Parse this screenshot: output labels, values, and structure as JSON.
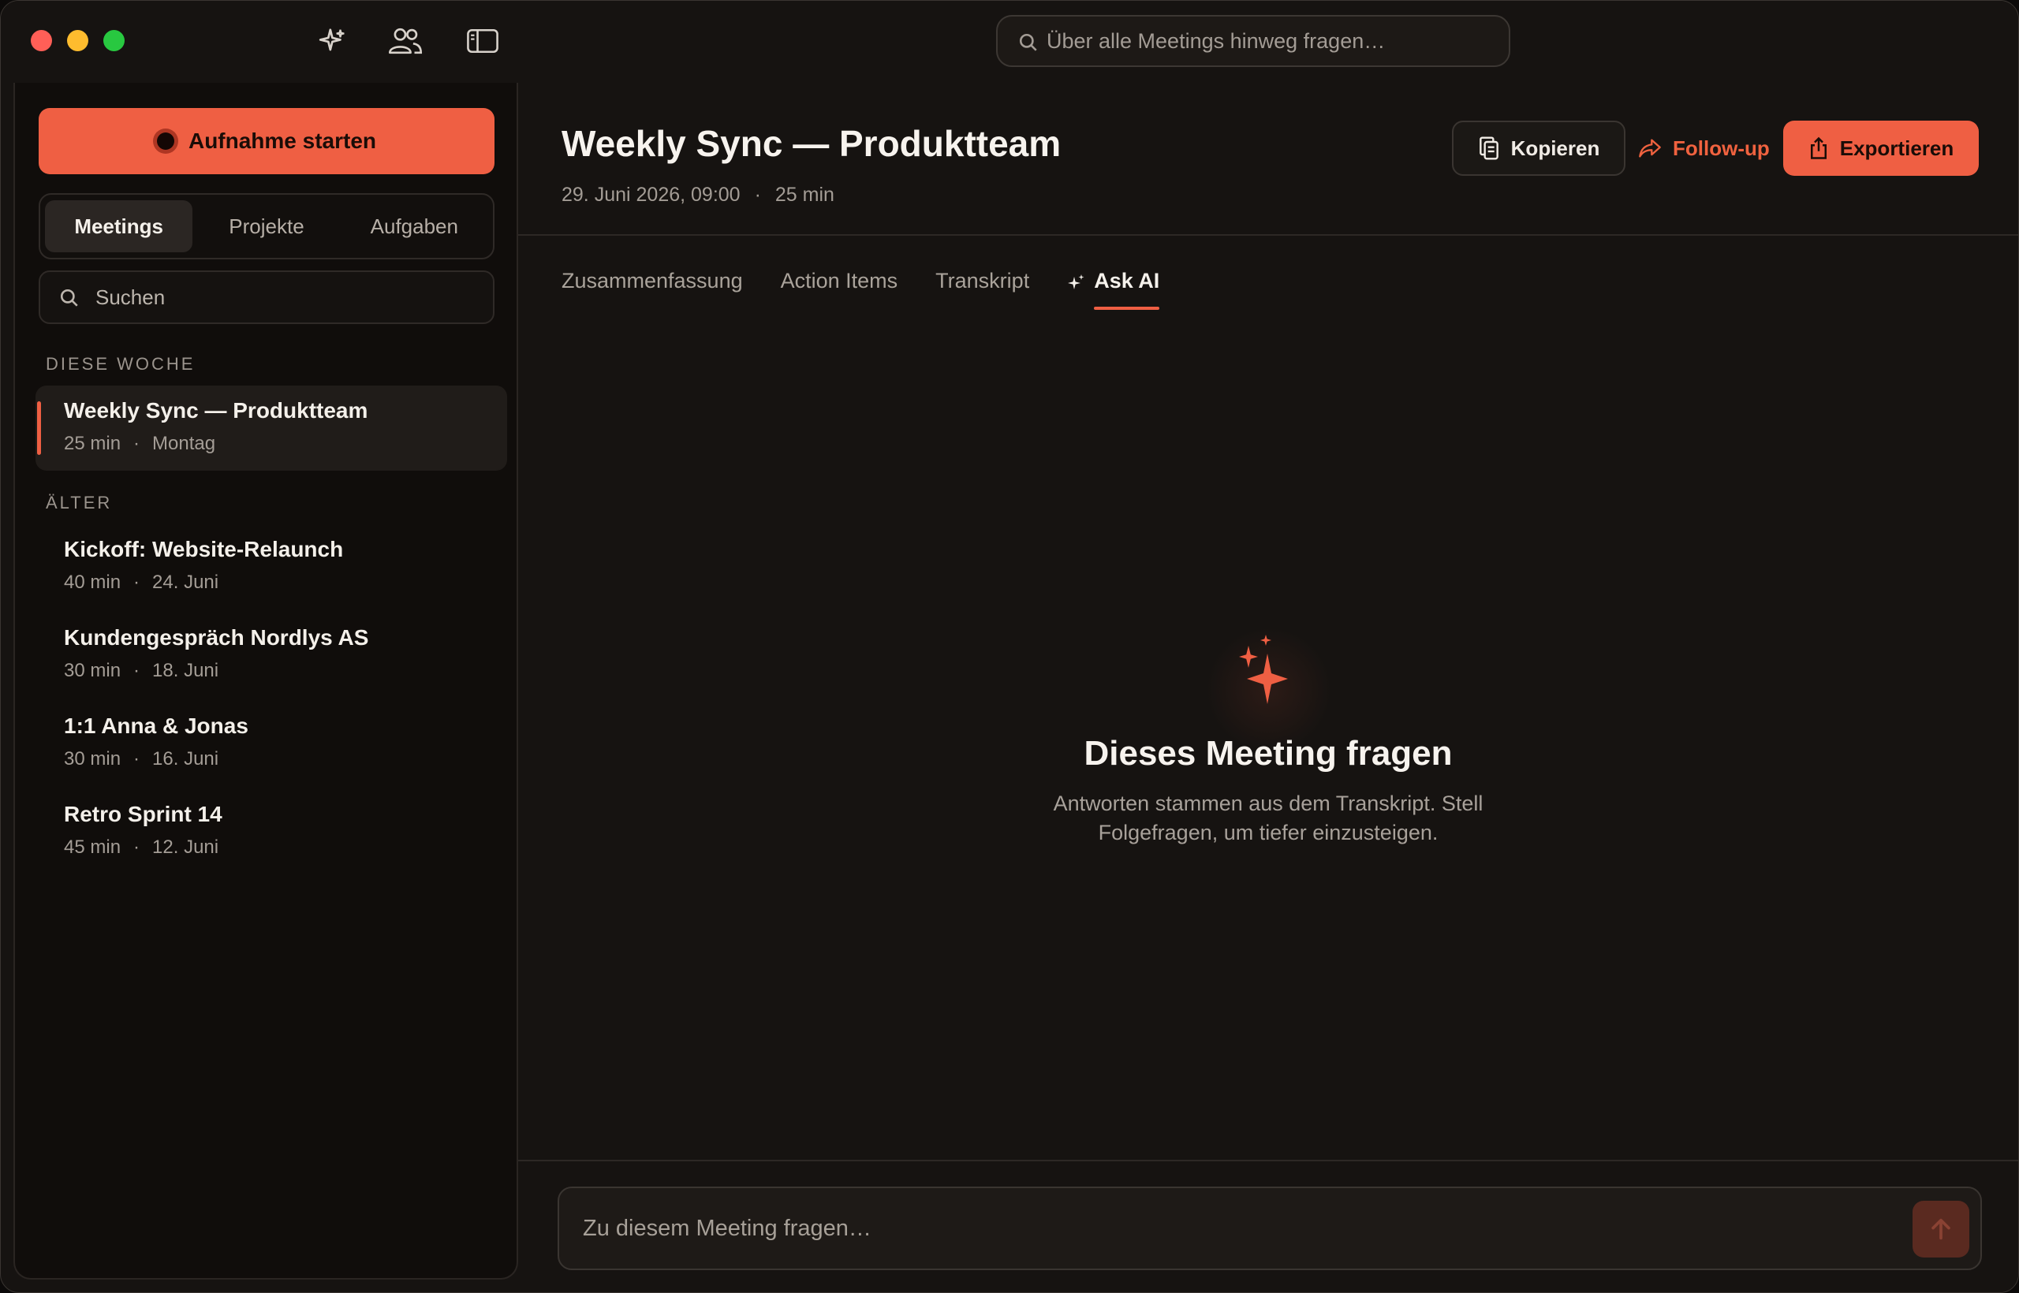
{
  "titlebar": {
    "global_search_placeholder": "Über alle Meetings hinweg fragen…"
  },
  "sidebar": {
    "record_label": "Aufnahme starten",
    "segments": [
      "Meetings",
      "Projekte",
      "Aufgaben"
    ],
    "active_segment": "Meetings",
    "search_placeholder": "Suchen",
    "sections": [
      {
        "heading": "DIESE WOCHE",
        "items": [
          {
            "title": "Weekly Sync — Produktteam",
            "duration": "25 min",
            "date": "Montag",
            "active": true
          }
        ]
      },
      {
        "heading": "ÄLTER",
        "items": [
          {
            "title": "Kickoff: Website-Relaunch",
            "duration": "40 min",
            "date": "24. Juni"
          },
          {
            "title": "Kundengespräch Nordlys AS",
            "duration": "30 min",
            "date": "18. Juni"
          },
          {
            "title": "1:1 Anna & Jonas",
            "duration": "30 min",
            "date": "16. Juni"
          },
          {
            "title": "Retro Sprint 14",
            "duration": "45 min",
            "date": "12. Juni"
          }
        ]
      }
    ]
  },
  "main": {
    "title": "Weekly Sync — Produktteam",
    "date": "29. Juni 2026, 09:00",
    "duration": "25 min",
    "actions": {
      "copy": "Kopieren",
      "follow_up": "Follow-up",
      "export": "Exportieren"
    },
    "tabs": [
      "Zusammenfassung",
      "Action Items",
      "Transkript",
      "Ask AI"
    ],
    "active_tab": "Ask AI",
    "empty_state": {
      "title": "Dieses Meeting fragen",
      "subtitle": "Antworten stammen aus dem Transkript. Stell Folgefragen, um tiefer einzusteigen."
    },
    "composer_placeholder": "Zu diesem Meeting fragen…"
  },
  "colors": {
    "accent": "#ef5f43",
    "background": "#161311",
    "sidebar_bg": "#100d0b"
  }
}
